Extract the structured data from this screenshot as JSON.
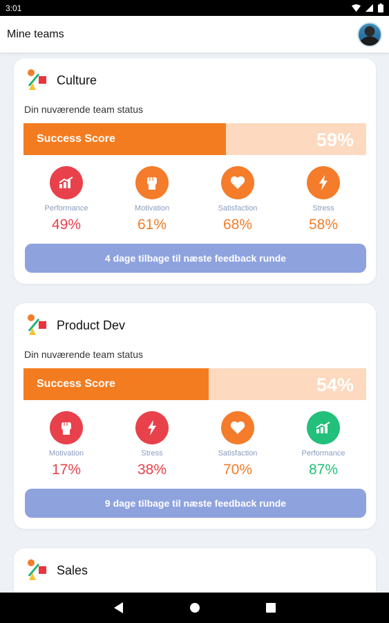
{
  "status_bar": {
    "time": "3:01"
  },
  "app_bar": {
    "title": "Mine teams"
  },
  "cards": [
    {
      "name": "Culture",
      "status_label": "Din nuværende team status",
      "score_label": "Success Score",
      "score_value": "59%",
      "score_fraction": 0.59,
      "metrics": [
        {
          "name": "Performance",
          "value": "49%",
          "icon": "chart-icon",
          "color": "#e8414b"
        },
        {
          "name": "Motivation",
          "value": "61%",
          "icon": "fist-icon",
          "color": "#f47c2a"
        },
        {
          "name": "Satisfaction",
          "value": "68%",
          "icon": "heart-icon",
          "color": "#f47c2a"
        },
        {
          "name": "Stress",
          "value": "58%",
          "icon": "bolt-icon",
          "color": "#f47c2a"
        }
      ],
      "feedback": "4 dage tilbage til næste feedback runde"
    },
    {
      "name": "Product Dev",
      "status_label": "Din nuværende team status",
      "score_label": "Success Score",
      "score_value": "54%",
      "score_fraction": 0.54,
      "metrics": [
        {
          "name": "Motivation",
          "value": "17%",
          "icon": "fist-icon",
          "color": "#e8414b"
        },
        {
          "name": "Stress",
          "value": "38%",
          "icon": "bolt-icon",
          "color": "#e8414b"
        },
        {
          "name": "Satisfaction",
          "value": "70%",
          "icon": "heart-icon",
          "color": "#f47c2a"
        },
        {
          "name": "Performance",
          "value": "87%",
          "icon": "chart-icon",
          "color": "#22c07a"
        }
      ],
      "feedback": "9 dage tilbage til næste feedback runde"
    },
    {
      "name": "Sales"
    }
  ]
}
